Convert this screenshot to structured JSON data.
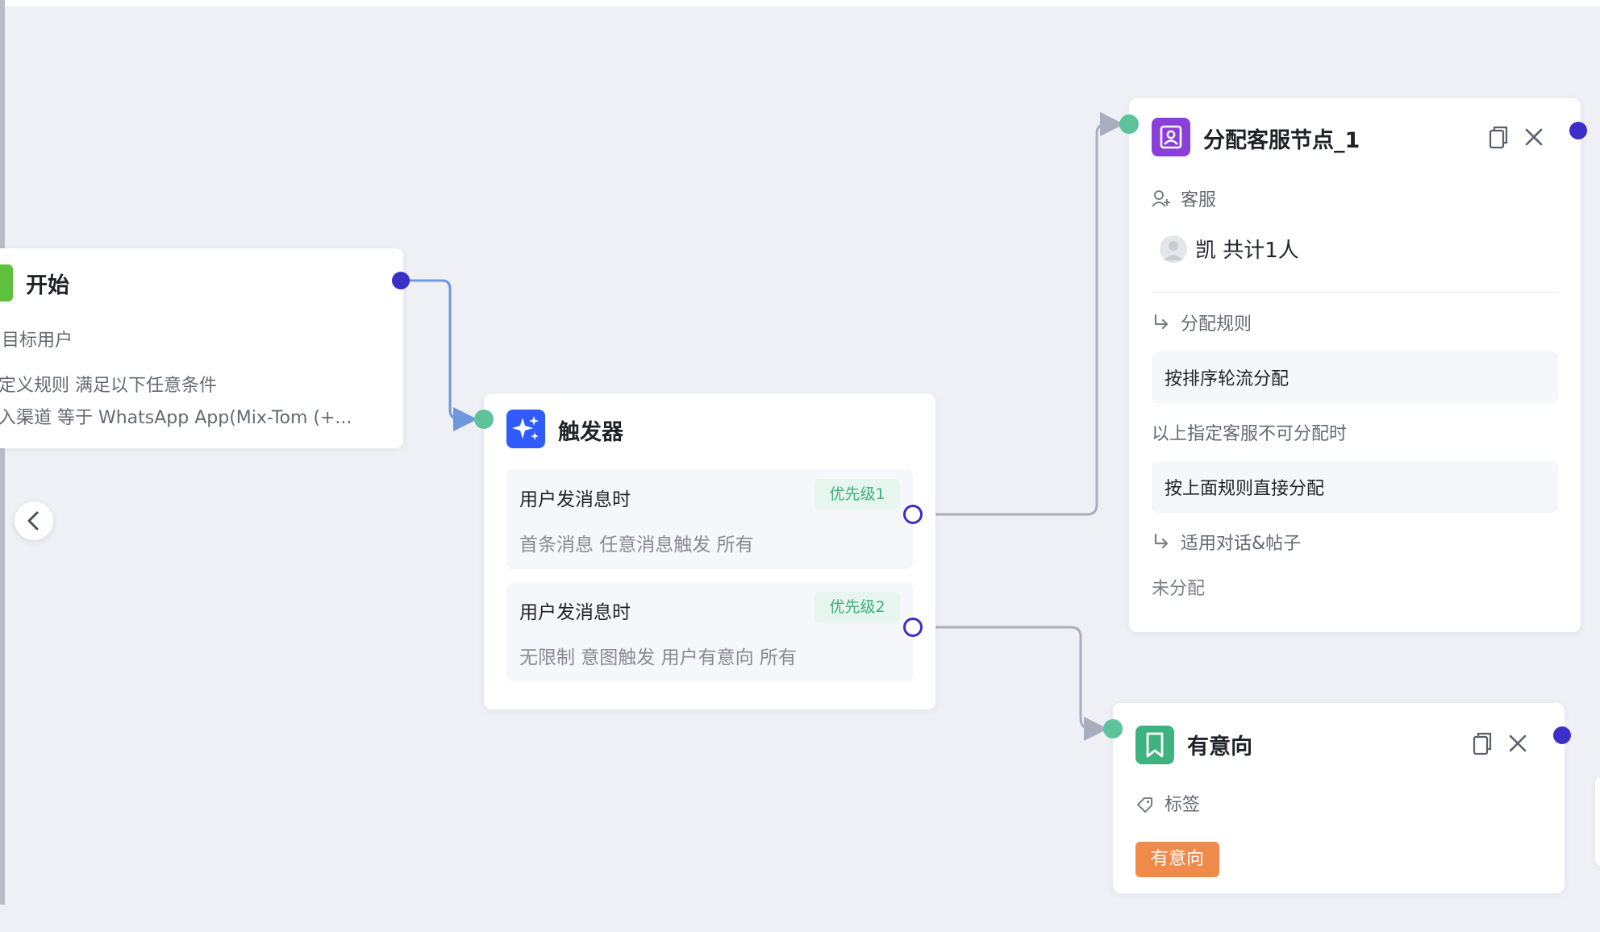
{
  "colors": {
    "canvas": "#eef0f5",
    "connector_green": "#5ec39a",
    "connector_blue": "#3b2ec9",
    "edge_blue": "#6f97dd",
    "edge_gray": "#a9adbd",
    "trigger_icon": "#2f5bff",
    "assign_icon": "#8b3fd9",
    "intent_icon": "#3fb37f",
    "intent_tag": "#f08a4b",
    "priority_badge_bg": "#e6f6ee",
    "priority_badge_text": "#3fae7a"
  },
  "start_node": {
    "title": "开始",
    "section_label": "目标用户",
    "rule_line": "定义规则  满足以下任意条件",
    "condition_line": "入渠道  等于  WhatsApp App(Mix-Tom (+..."
  },
  "trigger_node": {
    "title": "触发器",
    "icon": "sparkle-icon",
    "rules": [
      {
        "title": "用户发消息时",
        "priority": "优先级1",
        "details": "首条消息   任意消息触发   所有"
      },
      {
        "title": "用户发消息时",
        "priority": "优先级2",
        "details": "无限制   意图触发   用户有意向     所有"
      }
    ]
  },
  "assign_node": {
    "title": "分配客服节点_1",
    "icon": "agent-icon",
    "agent_label": "客服",
    "agent_summary": "凯  共计1人",
    "rule_label": "分配规则",
    "rule_value": "按排序轮流分配",
    "fallback_label": "以上指定客服不可分配时",
    "fallback_value": "按上面规则直接分配",
    "scope_label": "适用对话&帖子",
    "scope_value": "未分配"
  },
  "intent_node": {
    "title": "有意向",
    "icon": "bookmark-icon",
    "tag_label": "标签",
    "tag_value": "有意向"
  },
  "actions": {
    "copy_icon": "copy-icon",
    "close_icon": "close-icon",
    "back_icon": "chevron-left-icon"
  }
}
